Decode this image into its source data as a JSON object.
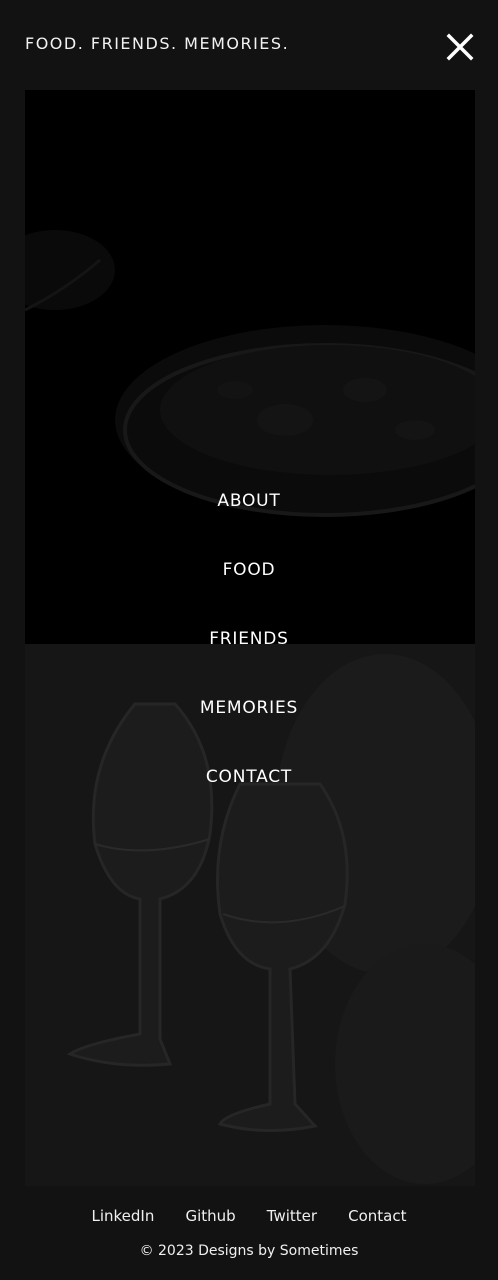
{
  "header": {
    "brand": "FOOD. FRIENDS. MEMORIES.",
    "close_icon": "close-icon"
  },
  "menu": {
    "items": [
      {
        "label": "ABOUT"
      },
      {
        "label": "FOOD"
      },
      {
        "label": "FRIENDS"
      },
      {
        "label": "MEMORIES"
      },
      {
        "label": "CONTACT"
      }
    ]
  },
  "footer": {
    "links": [
      {
        "label": "LinkedIn"
      },
      {
        "label": "Github"
      },
      {
        "label": "Twitter"
      },
      {
        "label": "Contact"
      }
    ],
    "copyright": "© 2023 Designs by Sometimes"
  },
  "colors": {
    "background": "#121212",
    "text": "#ffffff",
    "hero_top": "#000000",
    "hero_bottom": "#161616"
  }
}
